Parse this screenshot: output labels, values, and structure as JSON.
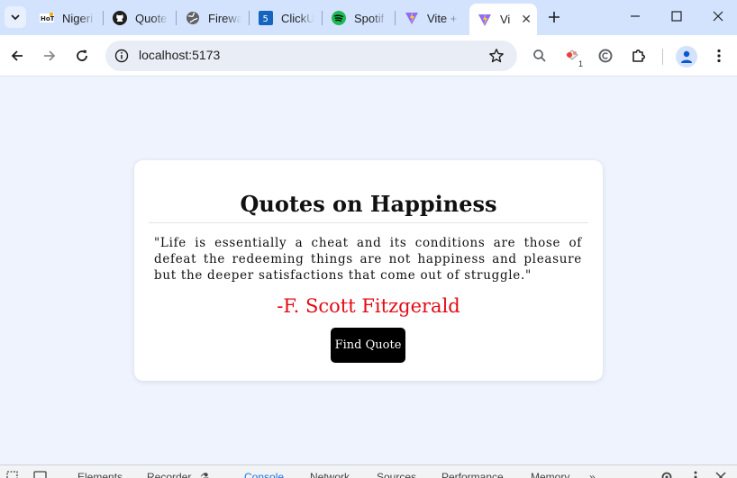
{
  "browser": {
    "tabs": [
      {
        "title": "Nigeri",
        "icon": "hot-logo-icon"
      },
      {
        "title": "Quote",
        "icon": "github-icon"
      },
      {
        "title": "Firewa",
        "icon": "globe-icon"
      },
      {
        "title": "ClickU",
        "icon": "clickup-icon"
      },
      {
        "title": "Spotif",
        "icon": "spotify-icon"
      },
      {
        "title": "Vite +",
        "icon": "vite-icon"
      },
      {
        "title": "Vi",
        "icon": "vite-icon",
        "active": true
      }
    ],
    "address_bar": {
      "url": "localhost:5173"
    },
    "extension_badge": "1",
    "colors": {
      "tabstrip": "#d3e3fd",
      "toolbar": "#ffffff",
      "page_bg": "#eef3fd"
    }
  },
  "page": {
    "title": "Quotes on Happiness",
    "quote": "\"Life is essentially a cheat and its conditions are those of defeat the redeeming things are not happiness and pleasure but the deeper satisfactions that come out of struggle.\"",
    "author": "-F. Scott Fitzgerald",
    "button_label": "Find Quote",
    "colors": {
      "author": "#e50914",
      "button_bg": "#000000",
      "button_text": "#ffffff"
    }
  },
  "devtools": {
    "tabs": [
      "Elements",
      "Recorder",
      "Console",
      "Network",
      "Sources",
      "Performance",
      "Memory"
    ],
    "active_tab": "Console"
  }
}
